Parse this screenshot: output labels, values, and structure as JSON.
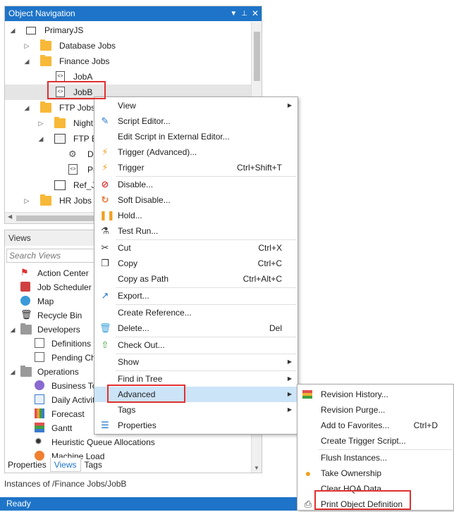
{
  "nav_pane": {
    "title": "Object Navigation",
    "tree": [
      {
        "label": "PrimaryJS"
      },
      {
        "label": "Database Jobs"
      },
      {
        "label": "Finance Jobs"
      },
      {
        "label": "JobA"
      },
      {
        "label": "JobB"
      },
      {
        "label": "FTP Jobs"
      },
      {
        "label": "Night"
      },
      {
        "label": "FTP B"
      },
      {
        "label": "D"
      },
      {
        "label": "Pr"
      },
      {
        "label": "Ref_Jo"
      },
      {
        "label": "HR Jobs"
      }
    ]
  },
  "views_pane": {
    "title": "Views",
    "search_placeholder": "Search Views",
    "items": [
      {
        "label": "Action Center"
      },
      {
        "label": "Job Scheduler I"
      },
      {
        "label": "Map"
      },
      {
        "label": "Recycle Bin"
      },
      {
        "label": "Developers"
      },
      {
        "label": "Definitions"
      },
      {
        "label": "Pending Ch"
      },
      {
        "label": "Operations"
      },
      {
        "label": "Business To"
      },
      {
        "label": "Daily Activit"
      },
      {
        "label": "Forecast"
      },
      {
        "label": "Gantt"
      },
      {
        "label": "Heuristic Queue Allocations"
      },
      {
        "label": "Machine Load"
      }
    ]
  },
  "bottom_tabs": [
    "Properties",
    "Views",
    "Tags"
  ],
  "info_line": "Instances of /Finance Jobs/JobB",
  "status": "Ready",
  "context_menu": {
    "items": [
      {
        "label": "View",
        "shortcut": ""
      },
      {
        "label": "Script Editor...",
        "shortcut": ""
      },
      {
        "label": "Edit Script in External Editor...",
        "shortcut": ""
      },
      {
        "label": "Trigger (Advanced)...",
        "shortcut": ""
      },
      {
        "label": "Trigger",
        "shortcut": "Ctrl+Shift+T"
      },
      {
        "label": "Disable...",
        "shortcut": ""
      },
      {
        "label": "Soft Disable...",
        "shortcut": ""
      },
      {
        "label": "Hold...",
        "shortcut": ""
      },
      {
        "label": "Test Run...",
        "shortcut": ""
      },
      {
        "label": "Cut",
        "shortcut": "Ctrl+X"
      },
      {
        "label": "Copy",
        "shortcut": "Ctrl+C"
      },
      {
        "label": "Copy as Path",
        "shortcut": "Ctrl+Alt+C"
      },
      {
        "label": "Export...",
        "shortcut": ""
      },
      {
        "label": "Create Reference...",
        "shortcut": ""
      },
      {
        "label": "Delete...",
        "shortcut": "Del"
      },
      {
        "label": "Check Out...",
        "shortcut": ""
      },
      {
        "label": "Show",
        "shortcut": ""
      },
      {
        "label": "Find in Tree",
        "shortcut": ""
      },
      {
        "label": "Advanced",
        "shortcut": ""
      },
      {
        "label": "Tags",
        "shortcut": ""
      },
      {
        "label": "Properties",
        "shortcut": ""
      }
    ]
  },
  "submenu": {
    "items": [
      {
        "label": "Revision History...",
        "shortcut": ""
      },
      {
        "label": "Revision Purge...",
        "shortcut": ""
      },
      {
        "label": "Add to Favorites...",
        "shortcut": "Ctrl+D"
      },
      {
        "label": "Create Trigger Script...",
        "shortcut": ""
      },
      {
        "label": "Flush Instances...",
        "shortcut": ""
      },
      {
        "label": "Take Ownership",
        "shortcut": ""
      },
      {
        "label": "Clear HQA Data",
        "shortcut": ""
      },
      {
        "label": "Print Object Definition",
        "shortcut": ""
      }
    ]
  },
  "colors": {
    "accent": "#1e74c8",
    "highlight": "#cce4f7",
    "annotation_box": "#e03030"
  }
}
